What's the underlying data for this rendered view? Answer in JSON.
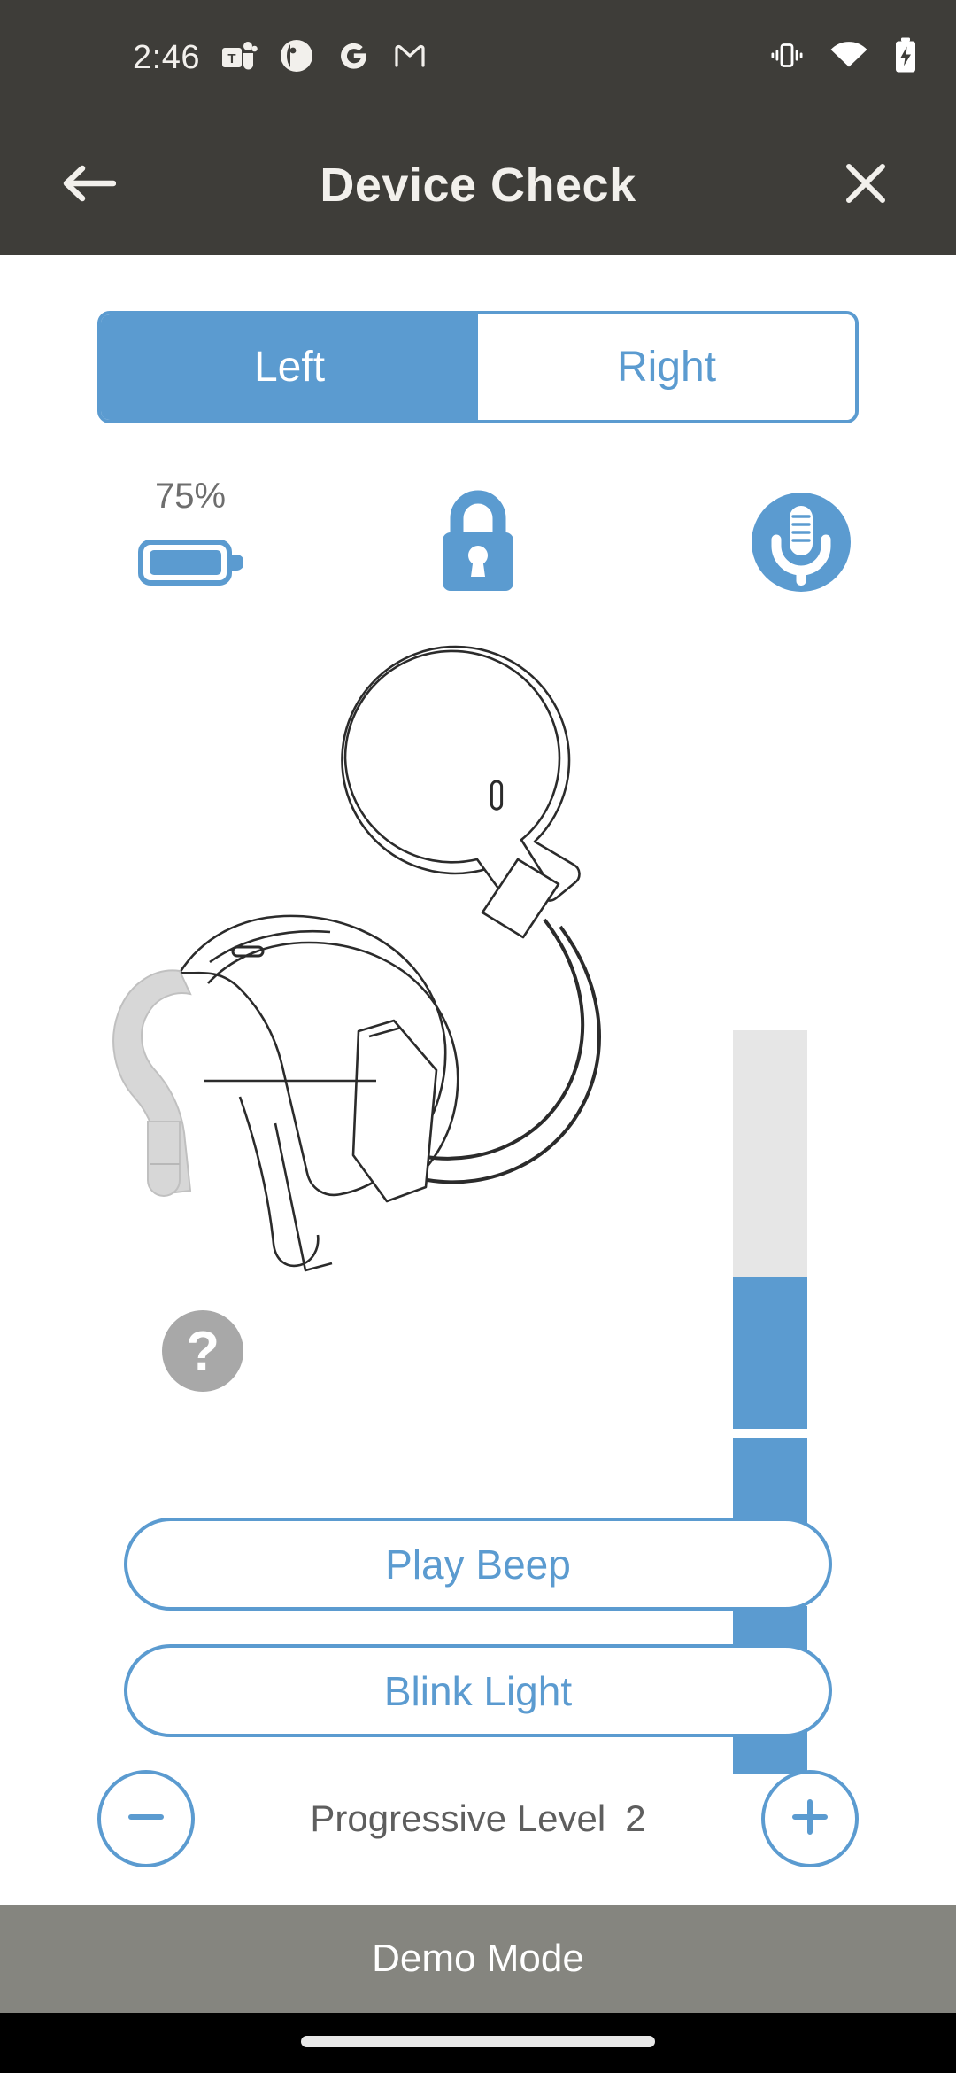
{
  "status_bar": {
    "clock": "2:46",
    "notification_icons": [
      "teams-icon",
      "outlook-icon",
      "google-icon",
      "gmail-icon"
    ],
    "system_icons": [
      "vibrate-icon",
      "wifi-icon",
      "battery-charging-icon"
    ]
  },
  "header": {
    "title": "Device Check",
    "back_icon": "arrow-left-icon",
    "close_icon": "close-icon"
  },
  "side_toggle": {
    "options": [
      {
        "label": "Left",
        "selected": true
      },
      {
        "label": "Right",
        "selected": false
      }
    ]
  },
  "device_status": {
    "battery": {
      "percent_label": "75%",
      "icon": "battery-icon",
      "fill_ratio": 0.95
    },
    "lock": {
      "icon": "lock-closed-icon",
      "state": "locked"
    },
    "microphone": {
      "icon": "microphone-icon",
      "state": "on"
    }
  },
  "illustration": {
    "device_icon": "hearing-device-illustration",
    "help_badge": "?",
    "help_badge_icon": "question-mark-icon"
  },
  "level_indicator": {
    "total_segments": 4,
    "filled_segments": 3,
    "segments": [
      {
        "state": "empty"
      },
      {
        "state": "filled"
      },
      {
        "state": "filled"
      },
      {
        "state": "filled"
      }
    ]
  },
  "actions": {
    "play_beep_label": "Play Beep",
    "blink_light_label": "Blink Light"
  },
  "stepper": {
    "label": "Progressive Level",
    "value": "2",
    "decrease_icon": "minus-icon",
    "increase_icon": "plus-icon"
  },
  "footer": {
    "demo_mode_label": "Demo Mode"
  },
  "colors": {
    "accent_blue": "#5b9bd0",
    "header_dark": "#3e3d39",
    "demo_gray": "#85857f",
    "segment_empty": "#e6e6e6",
    "help_badge_gray": "#a8a8a8"
  }
}
